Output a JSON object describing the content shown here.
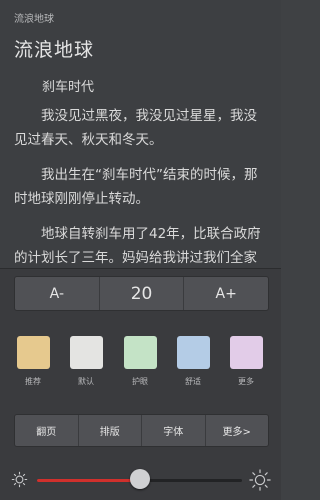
{
  "reader": {
    "book_name": "流浪地球",
    "chapter_title": "流浪地球",
    "section_title": "刹车时代",
    "paragraphs": [
      "我没见过黑夜，我没见过星星，我没见过春天、秋天和冬天。",
      "我出生在“刹车时代”结束的时候，那时地球刚刚停止转动。",
      "地球自转刹车用了42年，比联合政府的计划长了三年。妈妈给我讲过我们全家"
    ]
  },
  "font_size": {
    "decrease_label": "A-",
    "value": "20",
    "increase_label": "A+"
  },
  "themes": [
    {
      "label": "推荐",
      "color": "#e6c98e",
      "icon": "recommended-theme"
    },
    {
      "label": "默认",
      "color": "#e4e4e2",
      "icon": "default-theme"
    },
    {
      "label": "护眼",
      "color": "#c4e3c6",
      "icon": "eye-care-theme"
    },
    {
      "label": "舒适",
      "color": "#b4cce6",
      "icon": "comfort-theme"
    },
    {
      "label": "更多",
      "color": "#e2cce8",
      "icon": "more-theme"
    }
  ],
  "tabs": [
    {
      "label": "翻页"
    },
    {
      "label": "排版"
    },
    {
      "label": "字体"
    },
    {
      "label": "更多>"
    }
  ],
  "brightness": {
    "level": 0.5,
    "fill_color": "#d0302c",
    "icon_low": "sun-small-icon",
    "icon_high": "sun-large-icon"
  },
  "colors": {
    "background": "#3d3f42",
    "panel": "#3a3b3e",
    "control": "#505155",
    "accent": "#d0302c"
  }
}
